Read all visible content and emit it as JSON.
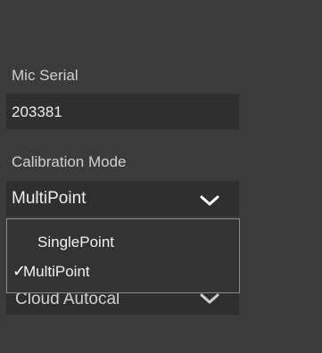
{
  "mic_serial": {
    "label": "Mic Serial",
    "value": "203381"
  },
  "calibration_mode": {
    "label": "Calibration Mode",
    "selected": "MultiPoint",
    "options": [
      {
        "label": "SinglePoint",
        "checked": false
      },
      {
        "label": "MultiPoint",
        "checked": true
      }
    ]
  },
  "obscured_select": {
    "value": "Cloud Autocal"
  },
  "icons": {
    "chevron": "chevron-down-icon",
    "check": "checkmark-icon",
    "check_glyph": "✓"
  }
}
